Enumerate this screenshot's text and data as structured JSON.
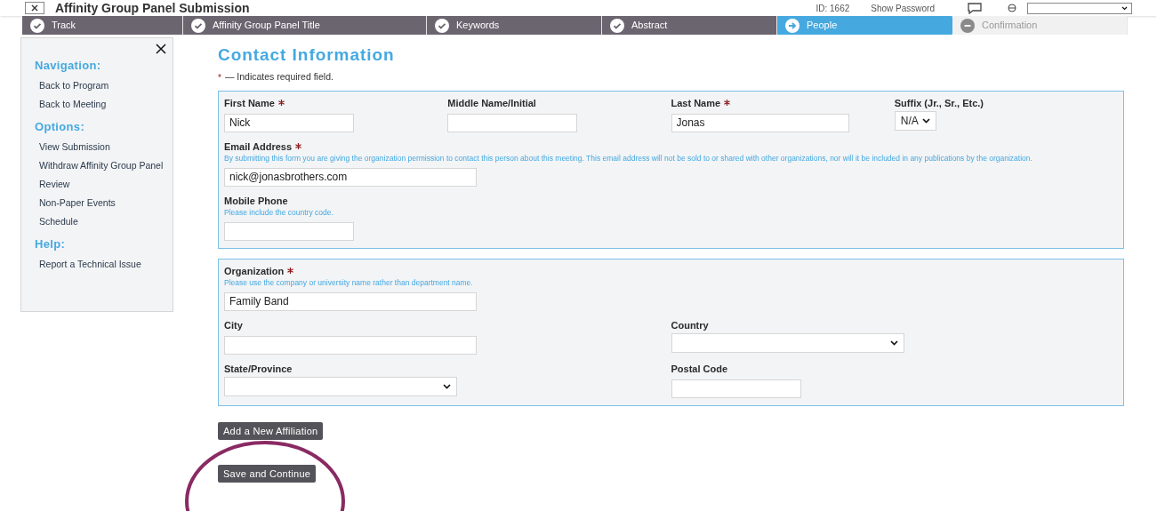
{
  "header": {
    "title": "Affinity Group Panel Submission",
    "id_text": "ID: 1662",
    "show_password": "Show Password"
  },
  "steps": [
    {
      "label": "Track",
      "completed": true,
      "selected": false
    },
    {
      "label": "Affinity Group Panel Title",
      "completed": true,
      "selected": false
    },
    {
      "label": "Keywords",
      "completed": true,
      "selected": false
    },
    {
      "label": "Abstract",
      "completed": true,
      "selected": false
    },
    {
      "label": "People",
      "completed": false,
      "selected": true
    },
    {
      "label": "Confirmation",
      "completed": false,
      "selected": false
    }
  ],
  "sidebar": {
    "groups": [
      {
        "heading": "Navigation:",
        "items": [
          "Back to Program",
          "Back to Meeting"
        ]
      },
      {
        "heading": "Options:",
        "items": [
          "View Submission",
          "Withdraw Affinity Group Panel",
          "Review",
          "Non-Paper Events",
          "Schedule"
        ]
      },
      {
        "heading": "Help:",
        "items": [
          "Report a Technical Issue"
        ]
      }
    ]
  },
  "title": "Contact Information",
  "required_note": {
    "mark": "*",
    "text": "— Indicates required field."
  },
  "sections": [
    {
      "rows": [
        [
          {
            "label": "First Name",
            "required": true,
            "kind": "short",
            "value": "Nick"
          },
          {
            "label": "Middle Name/Initial",
            "required": false,
            "kind": "short"
          },
          {
            "label": "Last Name",
            "required": true,
            "kind": "medium",
            "value": "Jonas"
          },
          {
            "label": "Suffix (Jr., Sr., Etc.)",
            "required": false,
            "kind": "select-small",
            "value": "N/A"
          }
        ],
        [
          {
            "label": "Email Address",
            "required": true,
            "kind": "long",
            "hint": "By submitting this form you are giving the organization permission to contact this person about this meeting. This email address will not be sold to or shared with other organizations, nor will it be included in any publications by the organization.",
            "value": "nick@jonasbrothers.com"
          }
        ],
        [
          {
            "label": "Mobile Phone",
            "required": false,
            "kind": "short",
            "hint": "Please include the country code."
          }
        ]
      ]
    },
    {
      "rows": [
        [
          {
            "label": "Organization",
            "required": true,
            "kind": "long",
            "hint": "Please use the company or university name rather than department name.",
            "value": "Family Band"
          }
        ],
        [
          {
            "label": "City",
            "required": false,
            "kind": "long"
          },
          {
            "label": "Country",
            "required": false,
            "kind": "select"
          }
        ],
        [
          {
            "label": "State/Province",
            "required": false,
            "kind": "select"
          },
          {
            "label": "Postal Code",
            "required": false,
            "kind": "short"
          }
        ]
      ]
    }
  ],
  "buttons": [
    "Add a New Affiliation",
    "Save and Continue"
  ]
}
